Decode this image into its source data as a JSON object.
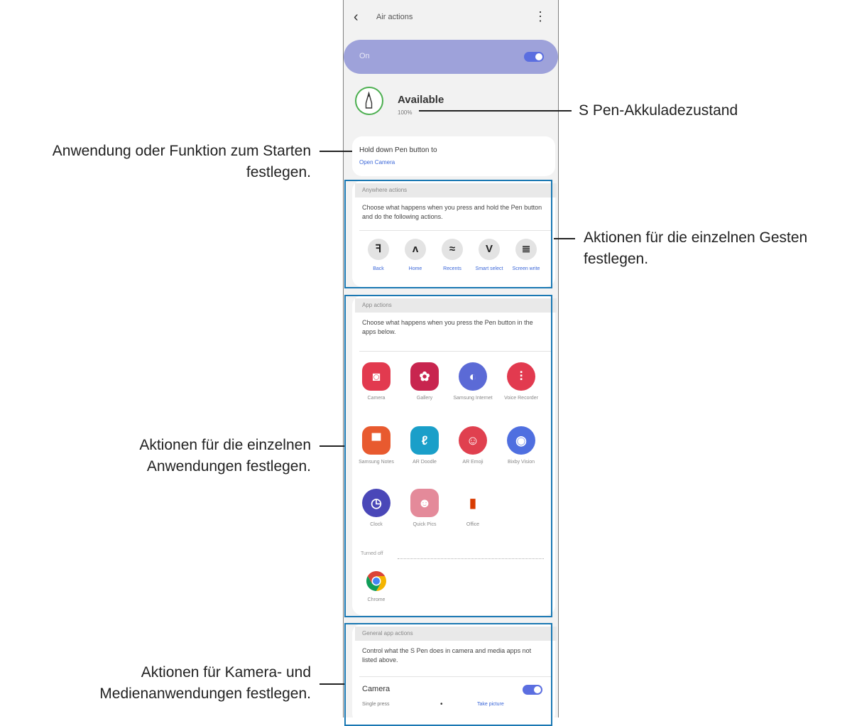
{
  "screen": {
    "back_icon": "chevron-left-icon",
    "title": "Air actions",
    "more_icon": "more-vertical-icon",
    "master_toggle": {
      "label": "On",
      "state": "on"
    },
    "pen_status": {
      "status": "Available",
      "sub": "100%",
      "icon": "s-pen-icon"
    },
    "pen_button": {
      "label": "Hold down Pen button to",
      "value": "Open Camera"
    },
    "gestures": {
      "header": "Anywhere actions",
      "description": "Choose what happens when you press and hold the Pen button and do the following actions.",
      "items": [
        {
          "glyph": "ꟻ",
          "label": "Back",
          "icon": "gesture-back-icon"
        },
        {
          "glyph": "ʌ",
          "label": "Home",
          "icon": "gesture-home-icon"
        },
        {
          "glyph": "≈",
          "label": "Recents",
          "icon": "gesture-recents-icon"
        },
        {
          "glyph": "V",
          "label": "Smart select",
          "icon": "gesture-smart-select-icon"
        },
        {
          "glyph": "≣",
          "label": "Screen write",
          "icon": "gesture-screen-write-icon"
        }
      ]
    },
    "app_actions": {
      "header": "App actions",
      "description": "Choose what happens when you press the Pen button in the apps below.",
      "apps": [
        {
          "name": "Camera",
          "glyph": "◙",
          "icon": "camera-app-icon",
          "color": "#e23a4f"
        },
        {
          "name": "Gallery",
          "glyph": "✿",
          "icon": "gallery-app-icon",
          "color": "#c8254f"
        },
        {
          "name": "Samsung Internet",
          "glyph": "◐",
          "icon": "samsung-internet-app-icon",
          "color": "#5b6ad6"
        },
        {
          "name": "Voice Recorder",
          "glyph": "⫶",
          "icon": "voice-recorder-app-icon",
          "color": "#e23a4f"
        },
        {
          "name": "Samsung Notes",
          "glyph": "▀",
          "icon": "samsung-notes-app-icon",
          "color": "#e85a2f"
        },
        {
          "name": "AR Doodle",
          "glyph": "ℓ",
          "icon": "ar-doodle-app-icon",
          "color": "#1a9fc9"
        },
        {
          "name": "AR Emoji",
          "glyph": "☺",
          "icon": "ar-emoji-app-icon",
          "color": "#e0404f"
        },
        {
          "name": "Bixby Vision",
          "glyph": "◉",
          "icon": "bixby-vision-app-icon",
          "color": "#4f6fe0"
        },
        {
          "name": "Clock",
          "glyph": "◷",
          "icon": "clock-app-icon",
          "color": "#4a47b8"
        },
        {
          "name": "Quick Pics",
          "glyph": "☻",
          "icon": "quick-pics-app-icon",
          "color": "#e48a9a"
        },
        {
          "name": "Office",
          "glyph": "▮",
          "icon": "office-app-icon",
          "color": "#ffffff"
        }
      ],
      "turned_off_label": "Turned off",
      "turned_off_apps": [
        {
          "name": "Chrome",
          "icon": "chrome-app-icon"
        }
      ]
    },
    "general_actions": {
      "header": "General app actions",
      "description": "Control what the S Pen does in camera and media apps not listed above.",
      "camera_label": "Camera",
      "camera_toggle_state": "on",
      "single_press_label": "Single press",
      "single_press_value": "Take picture"
    }
  },
  "callouts": {
    "battery": "S Pen-Akkuladezustand",
    "launch_line1": "Anwendung oder Funktion zum Starten",
    "launch_line2": "festlegen.",
    "gestures_line1": "Aktionen für die einzelnen Gesten",
    "gestures_line2": "festlegen.",
    "apps_line1": "Aktionen für die einzelnen",
    "apps_line2": "Anwendungen festlegen.",
    "media_line1": "Aktionen für Kamera- und",
    "media_line2": "Medienanwendungen festlegen."
  },
  "colors": {
    "callout_box": "#1a78b3",
    "accent": "#3a66d8",
    "toggle": "#5b6ee0",
    "on_bar": "#9ea2da",
    "battery_ring": "#4caf50"
  }
}
